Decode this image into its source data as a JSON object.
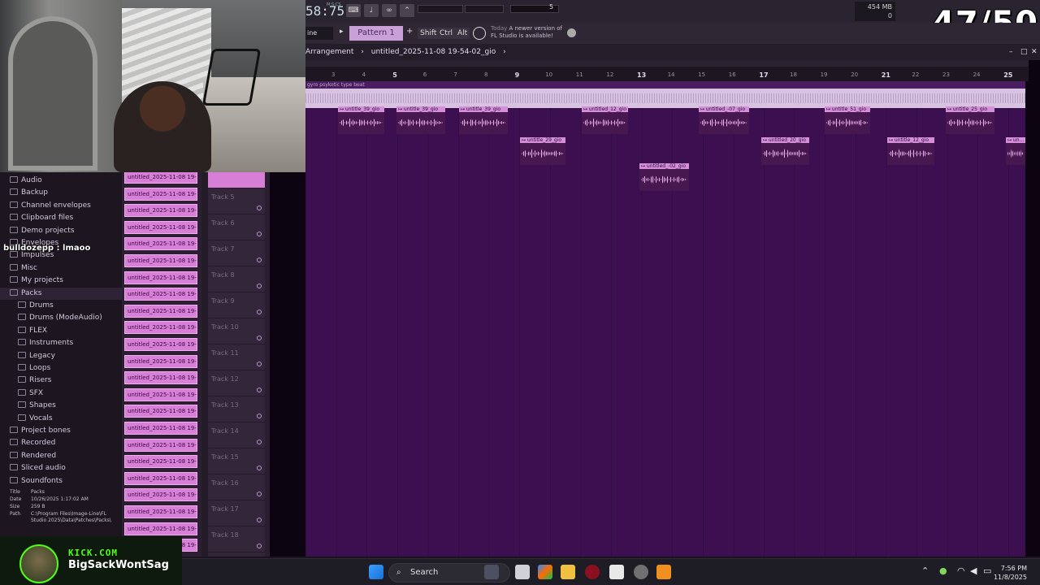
{
  "counter": "47/50",
  "chat_overlay": "bulldozepp : lmaoo",
  "kick": {
    "site": "KICK.COM",
    "name": "BigSackWontSag"
  },
  "toolbar": {
    "time": "58:75",
    "msecs": "M:S:CS",
    "cpu_mem": "454 MB",
    "cpu_num": "5",
    "cpu_zero": "0",
    "mode_label": "ine",
    "pattern_label": "Pattern 1",
    "shift": "Shift",
    "ctrl": "Ctrl",
    "alt": "Alt",
    "news_day": "Today",
    "news_text": "A newer version of",
    "news_text2": "FL Studio is available!"
  },
  "arrangement": {
    "crumb1": "Arrangement",
    "crumb_sep": "›",
    "crumb2": "untitled_2025-11-08 19-54-02_gio",
    "crumb_arrow": "›",
    "min": "–",
    "max": "□",
    "close": "✕"
  },
  "ruler": {
    "bars": [
      "3",
      "4",
      "5",
      "6",
      "7",
      "8",
      "9",
      "10",
      "11",
      "12",
      "13",
      "14",
      "15",
      "16",
      "17",
      "18",
      "19",
      "20",
      "21",
      "22",
      "23",
      "24",
      "25"
    ],
    "major": [
      "5",
      "9",
      "13",
      "17",
      "21",
      "25"
    ]
  },
  "audio_track_label": "gyro psykotic type beat",
  "clips": [
    {
      "label": "untitle_39_gio"
    },
    {
      "label": "untitle_39_gio"
    },
    {
      "label": "untitle_39_gio"
    },
    {
      "label": "untitled_12_gio"
    },
    {
      "label": "untitled_-07_gio"
    },
    {
      "label": "untitle_51_gio"
    },
    {
      "label": "untitle_25_gio"
    },
    {
      "label": "untitle_29_gio"
    },
    {
      "label": "untitled_20_gio"
    },
    {
      "label": "untitle_12_gio"
    },
    {
      "label": "un..."
    },
    {
      "label": "untitled_-02_gio"
    }
  ],
  "browser": {
    "items": [
      {
        "label": "Audio",
        "kind": "top"
      },
      {
        "label": "Backup",
        "kind": "top"
      },
      {
        "label": "Channel envelopes",
        "kind": "top"
      },
      {
        "label": "Clipboard files",
        "kind": "top"
      },
      {
        "label": "Demo projects",
        "kind": "top"
      },
      {
        "label": "Envelopes",
        "kind": "top"
      },
      {
        "label": "Impulses",
        "kind": "top"
      },
      {
        "label": "Misc",
        "kind": "top"
      },
      {
        "label": "My projects",
        "kind": "top"
      },
      {
        "label": "Packs",
        "kind": "sel"
      },
      {
        "label": "Drums",
        "kind": "sub"
      },
      {
        "label": "Drums (ModeAudio)",
        "kind": "sub"
      },
      {
        "label": "FLEX",
        "kind": "sub"
      },
      {
        "label": "Instruments",
        "kind": "sub"
      },
      {
        "label": "Legacy",
        "kind": "sub"
      },
      {
        "label": "Loops",
        "kind": "sub"
      },
      {
        "label": "Risers",
        "kind": "sub"
      },
      {
        "label": "SFX",
        "kind": "sub"
      },
      {
        "label": "Shapes",
        "kind": "sub"
      },
      {
        "label": "Vocals",
        "kind": "sub"
      },
      {
        "label": "Project bones",
        "kind": "top"
      },
      {
        "label": "Recorded",
        "kind": "top"
      },
      {
        "label": "Rendered",
        "kind": "top"
      },
      {
        "label": "Sliced audio",
        "kind": "top"
      },
      {
        "label": "Soundfonts",
        "kind": "top"
      }
    ],
    "info": {
      "title_k": "Title",
      "title_v": "Packs",
      "date_k": "Date",
      "date_v": "10/26/2025 1:17:02 AM",
      "size_k": "Size",
      "size_v": "259 B",
      "path_k": "Path",
      "path_v": "C:\\Program Files\\Image-Line\\FL Studio 2025\\Data\\Patches\\Packs\\"
    }
  },
  "channel_label": "untitled_2025-11-08 19-",
  "tracks": [
    "Track 5",
    "Track 6",
    "Track 7",
    "Track 8",
    "Track 9",
    "Track 10",
    "Track 11",
    "Track 12",
    "Track 13",
    "Track 14",
    "Track 15",
    "Track 16",
    "Track 17",
    "Track 18"
  ],
  "taskbar": {
    "search": "Search",
    "time": "7:56 PM",
    "date": "11/8/2025"
  },
  "colors": {
    "playlist_bg": "#3c0f50",
    "clip_header": "#d58fd8",
    "kick_green": "#53fc18"
  }
}
